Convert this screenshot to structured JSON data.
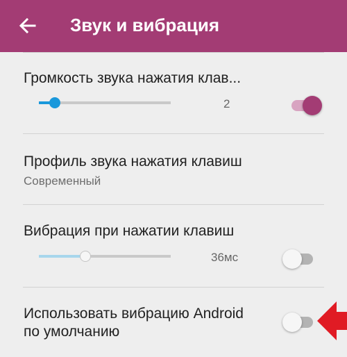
{
  "app_bar": {
    "title": "Звук и вибрация",
    "back_icon": "arrow-left-icon",
    "color": "#a33c74"
  },
  "settings": {
    "keypress_volume": {
      "title": "Громкость звука нажатия клав...",
      "value": "2",
      "slider_fraction": 0.12,
      "enabled": true
    },
    "keypress_sound_profile": {
      "title": "Профиль звука нажатия клавиш",
      "summary": "Современный"
    },
    "keypress_vibration": {
      "title": "Вибрация при нажатии клавиш",
      "value": "36мс",
      "slider_fraction": 0.35,
      "enabled": false
    },
    "android_default_vibration": {
      "title_line1": "Использовать вибрацию Android",
      "title_line2": "по умолчанию",
      "enabled": false
    }
  },
  "colors": {
    "accent": "#1a98db",
    "switch_on": "#a33c74",
    "annotation_arrow": "#e01b24"
  },
  "annotation": {
    "arrow_icon": "red-arrow-left-icon"
  }
}
